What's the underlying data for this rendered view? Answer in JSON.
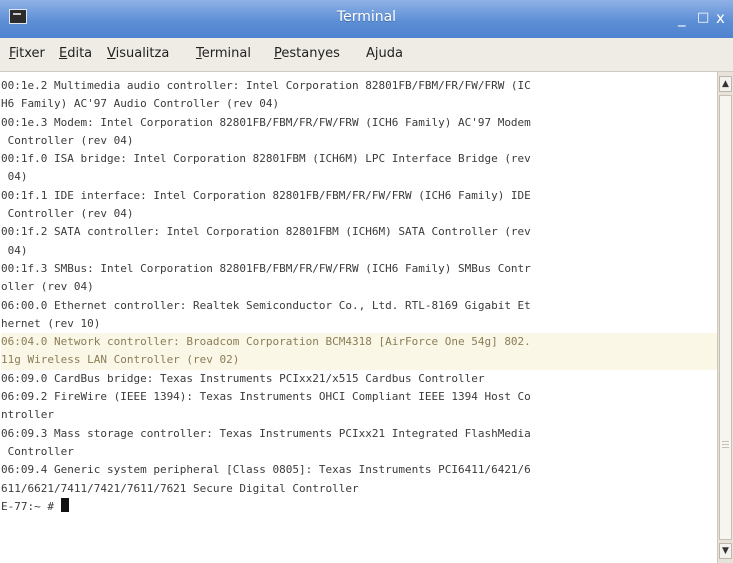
{
  "window": {
    "title": "Terminal",
    "min_glyph": "_",
    "max_glyph": "□",
    "close_glyph": "x"
  },
  "menu": [
    {
      "key": "F",
      "rest": "itxer"
    },
    {
      "key": "E",
      "rest": "dita"
    },
    {
      "key": "V",
      "rest": "isualitza"
    },
    {
      "key": "T",
      "rest": "erminal"
    },
    {
      "key": "P",
      "rest": "estanyes"
    },
    {
      "key": "j",
      "pre": "A",
      "rest": "uda"
    }
  ],
  "terminal": {
    "lines": [
      "00:1e.2 Multimedia audio controller: Intel Corporation 82801FB/FBM/FR/FW/FRW (IC",
      "H6 Family) AC'97 Audio Controller (rev 04)",
      "00:1e.3 Modem: Intel Corporation 82801FB/FBM/FR/FW/FRW (ICH6 Family) AC'97 Modem",
      " Controller (rev 04)",
      "00:1f.0 ISA bridge: Intel Corporation 82801FBM (ICH6M) LPC Interface Bridge (rev",
      " 04)",
      "00:1f.1 IDE interface: Intel Corporation 82801FB/FBM/FR/FW/FRW (ICH6 Family) IDE",
      " Controller (rev 04)",
      "00:1f.2 SATA controller: Intel Corporation 82801FBM (ICH6M) SATA Controller (rev",
      " 04)",
      "00:1f.3 SMBus: Intel Corporation 82801FB/FBM/FR/FW/FRW (ICH6 Family) SMBus Contr",
      "oller (rev 04)",
      "06:00.0 Ethernet controller: Realtek Semiconductor Co., Ltd. RTL-8169 Gigabit Et",
      "hernet (rev 10)",
      "06:04.0 Network controller: Broadcom Corporation BCM4318 [AirForce One 54g] 802.",
      "11g Wireless LAN Controller (rev 02)",
      "06:09.0 CardBus bridge: Texas Instruments PCIxx21/x515 Cardbus Controller",
      "06:09.2 FireWire (IEEE 1394): Texas Instruments OHCI Compliant IEEE 1394 Host Co",
      "ntroller",
      "06:09.3 Mass storage controller: Texas Instruments PCIxx21 Integrated FlashMedia",
      " Controller",
      "06:09.4 Generic system peripheral [Class 0805]: Texas Instruments PCI6411/6421/6",
      "611/6621/7411/7421/7611/7621 Secure Digital Controller"
    ],
    "highlighted_lines": [
      14,
      15
    ],
    "prompt": "E-77:~ # "
  }
}
